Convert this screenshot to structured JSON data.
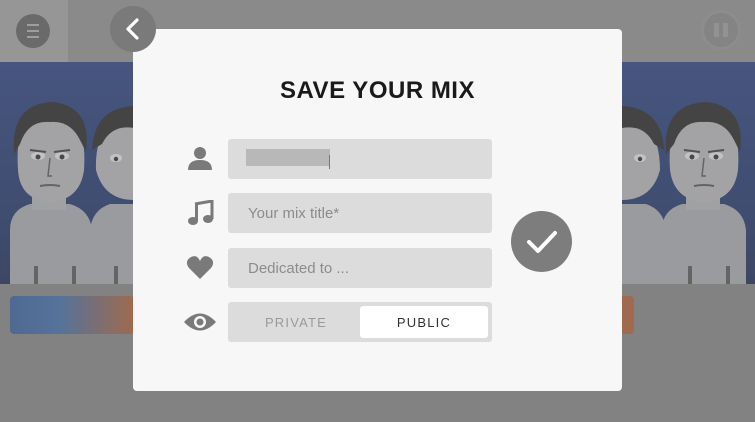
{
  "modal": {
    "title": "SAVE YOUR MIX",
    "name_field": {
      "value": "",
      "redacted": true
    },
    "title_field": {
      "placeholder": "Your mix title*"
    },
    "dedication_field": {
      "placeholder": "Dedicated to ..."
    },
    "visibility": {
      "options": [
        "PRIVATE",
        "PUBLIC"
      ],
      "selected": "PUBLIC"
    }
  },
  "icons": {
    "menu": "menu-icon",
    "pause": "pause-icon",
    "back": "chevron-left-icon",
    "user": "user-icon",
    "music": "music-note-icon",
    "heart": "heart-icon",
    "eye": "eye-icon",
    "confirm": "checkmark-icon"
  },
  "colors": {
    "modal_bg": "#f7f7f7",
    "field_bg": "#dcdcdc",
    "icon_gray": "#7a7a7a",
    "stage_blue": "#1f3a86"
  }
}
